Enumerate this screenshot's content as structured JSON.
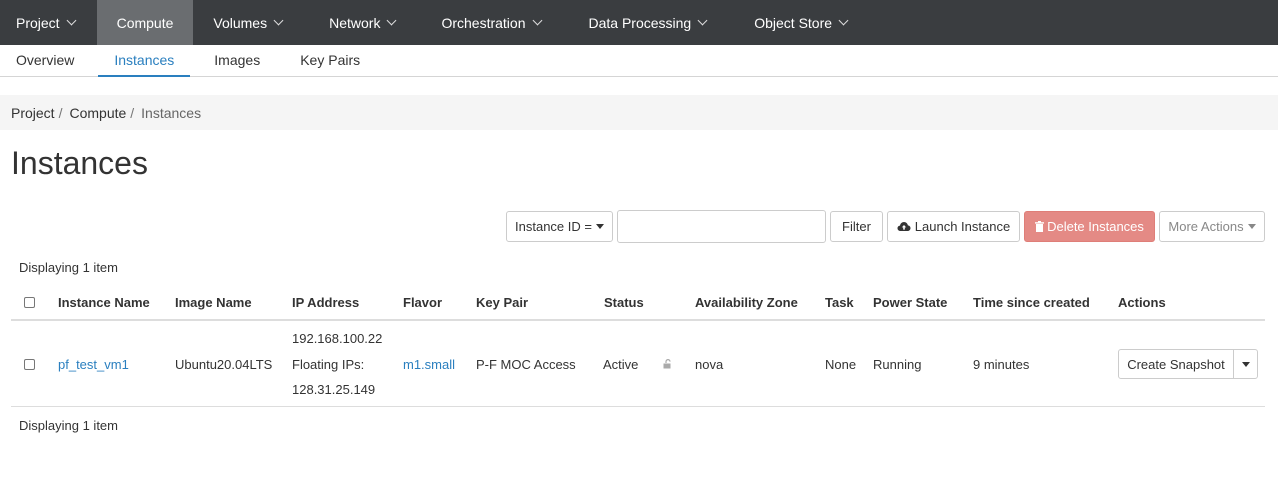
{
  "topnav": {
    "items": [
      {
        "label": "Project",
        "caret": true
      },
      {
        "label": "Compute",
        "caret": false,
        "active": true
      },
      {
        "label": "Volumes",
        "caret": true
      },
      {
        "label": "Network",
        "caret": true
      },
      {
        "label": "Orchestration",
        "caret": true
      },
      {
        "label": "Data Processing",
        "caret": true
      },
      {
        "label": "Object Store",
        "caret": true
      }
    ]
  },
  "subnav": {
    "tabs": [
      {
        "label": "Overview"
      },
      {
        "label": "Instances",
        "active": true
      },
      {
        "label": "Images"
      },
      {
        "label": "Key Pairs"
      }
    ]
  },
  "breadcrumb": {
    "items": [
      "Project",
      "Compute",
      "Instances"
    ]
  },
  "page": {
    "title": "Instances"
  },
  "toolbar": {
    "filter_field": "Instance ID =",
    "filter_input_value": "",
    "filter_button": "Filter",
    "launch_button": "Launch Instance",
    "delete_button": "Delete Instances",
    "more_actions": "More Actions"
  },
  "table": {
    "count_top": "Displaying 1 item",
    "count_bottom": "Displaying 1 item",
    "headers": {
      "name": "Instance Name",
      "image": "Image Name",
      "ip": "IP Address",
      "flavor": "Flavor",
      "keypair": "Key Pair",
      "status": "Status",
      "az": "Availability Zone",
      "task": "Task",
      "power": "Power State",
      "age": "Time since created",
      "actions": "Actions"
    },
    "rows": [
      {
        "name": "pf_test_vm1",
        "image": "Ubuntu20.04LTS",
        "ip_fixed": "192.168.100.22",
        "ip_floating_label": "Floating IPs:",
        "ip_floating": "128.31.25.149",
        "flavor": "m1.small",
        "keypair": "P-F MOC Access",
        "status": "Active",
        "az": "nova",
        "task": "None",
        "power": "Running",
        "age": "9 minutes",
        "action": "Create Snapshot"
      }
    ]
  },
  "colors": {
    "nav_bg": "#3a3d40",
    "nav_active": "#6a6d70",
    "link": "#2a7fbf",
    "danger": "#e48a85"
  },
  "icons": {
    "launch": "cloud-upload-icon",
    "delete": "trash-icon",
    "lock": "unlock-icon"
  }
}
